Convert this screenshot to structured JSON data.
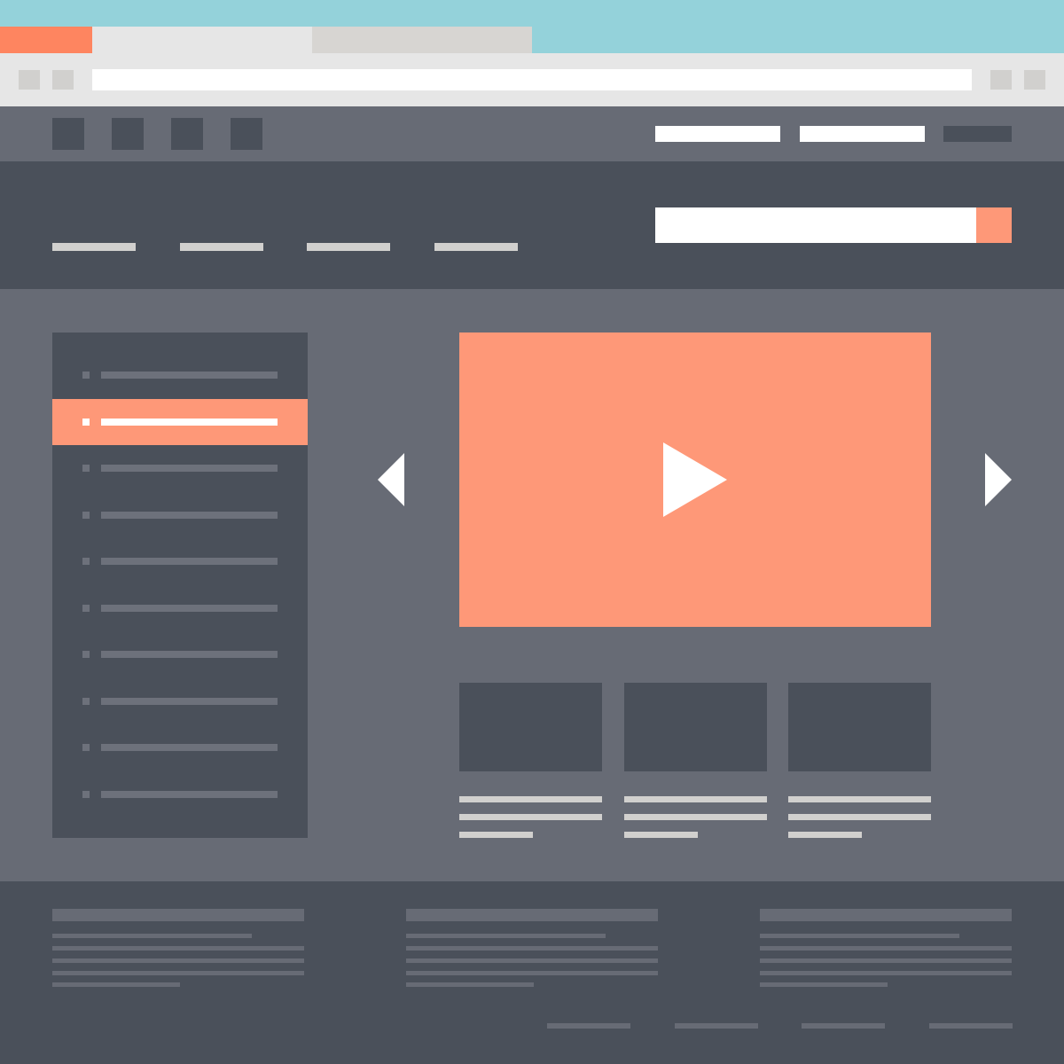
{
  "colors": {
    "browser_tabbar": "#94d2da",
    "accent": "#fe9878",
    "tab_active": "#fe8560",
    "tab_inactive_light": "#e6e6e6",
    "tab_inactive_dark": "#d7d5d2",
    "page_bg": "#676b75",
    "dark_panel": "#4a505a",
    "placeholder_light": "#d1d0ce",
    "placeholder_dark": "#6d717b",
    "white": "#ffffff"
  },
  "browser": {
    "tabs": [
      {
        "name": "tab-active",
        "state": "active"
      },
      {
        "name": "tab-2",
        "state": "inactive"
      },
      {
        "name": "tab-3",
        "state": "inactive"
      }
    ],
    "address_value": ""
  },
  "icons": {
    "play": "play-icon",
    "prev": "chevron-left-icon",
    "next": "chevron-right-icon"
  },
  "sidebar": {
    "item_count": 10,
    "active_index": 1
  },
  "thumbnails": {
    "count": 3
  },
  "footer": {
    "column_count": 3,
    "link_count": 4
  }
}
